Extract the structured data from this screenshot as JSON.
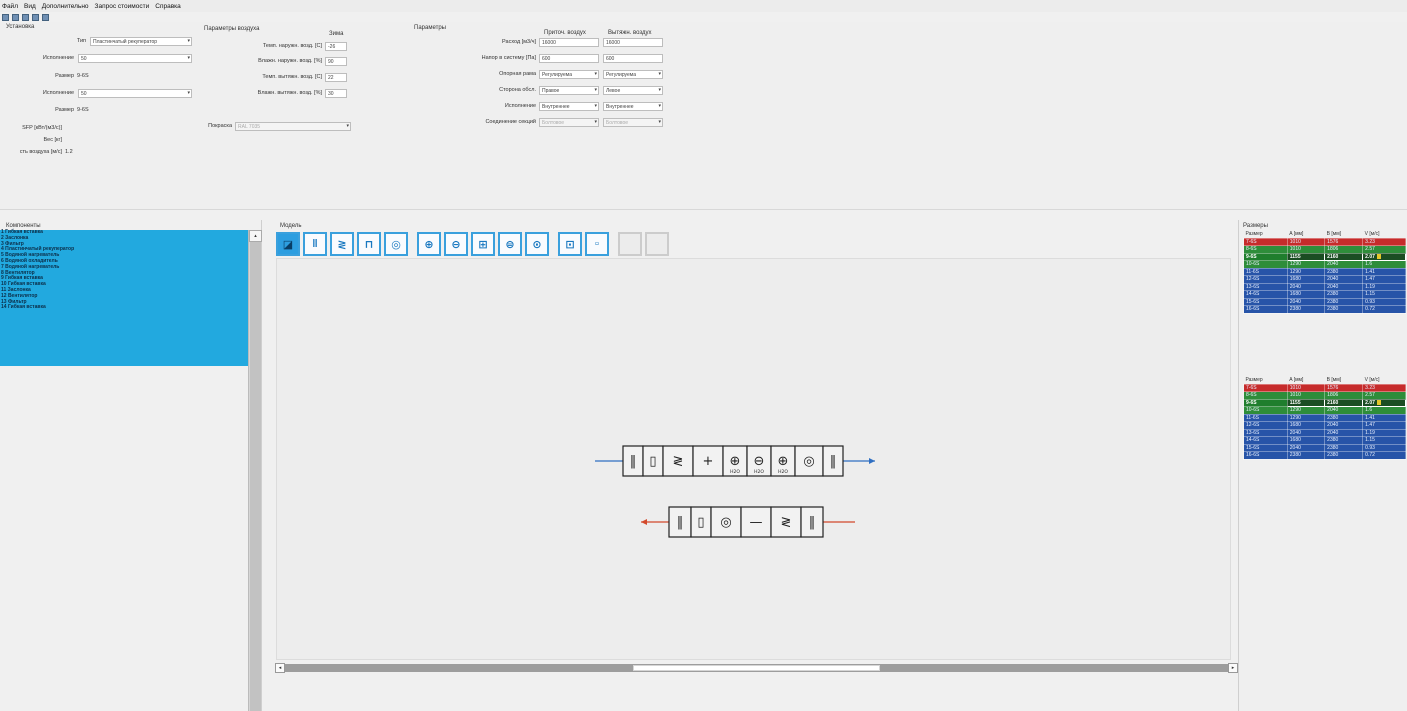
{
  "menu": [
    "Файл",
    "Вид",
    "Дополнительно",
    "Запрос стоимости",
    "Справка"
  ],
  "installation": {
    "title": "Установка",
    "type_label": "Тип",
    "type_value": "Пластинчатый рекуператор",
    "execution1_label": "Исполнение",
    "execution1_value": "50",
    "size1_label": "Размер",
    "size1_value": "9-6S",
    "execution2_label": "Исполнение",
    "execution2_value": "50",
    "size2_label": "Размер",
    "size2_value": "9-6S",
    "sfp_label": "SFP [кВт/(м3/с)]",
    "sfp_value": "",
    "weight_label": "Вес [кг]",
    "weight_value": "",
    "velocity_label": "сть воздуха [м/с]",
    "velocity_value": "1.2"
  },
  "air_params": {
    "title": "Параметры воздуха",
    "column_header": "Зима",
    "rows": [
      {
        "label": "Темп. наружн. возд. [C]",
        "value": "-26"
      },
      {
        "label": "Влажн. наружн. возд. [%]",
        "value": "90"
      },
      {
        "label": "Темп. вытяжн. возд. [C]",
        "value": "22"
      },
      {
        "label": "Влажн. вытяжн. возд. [%]",
        "value": "30"
      }
    ],
    "coating_label": "Покраска",
    "coating_value": "RAL 7035"
  },
  "params": {
    "title": "Параметры",
    "col_supply": "Приточ. воздух",
    "col_exhaust": "Вытяжн. воздух",
    "rows": [
      {
        "label": "Расход [м3/ч]",
        "supply": "16000",
        "exhaust": "16000",
        "kind": "input"
      },
      {
        "label": "Напор в систему [Па]",
        "supply": "600",
        "exhaust": "600",
        "kind": "input"
      },
      {
        "label": "Опорная рама",
        "supply": "Регулируема",
        "exhaust": "Регулируема",
        "kind": "select"
      },
      {
        "label": "Сторона обсл.",
        "supply": "Правое",
        "exhaust": "Левое",
        "kind": "select"
      },
      {
        "label": "Исполнение",
        "supply": "Внутреннее",
        "exhaust": "Внутреннее",
        "kind": "select"
      },
      {
        "label": "Соединение секций",
        "supply": "Болтовое",
        "exhaust": "Болтовое",
        "kind": "select-disabled"
      }
    ]
  },
  "components": {
    "title": "Компоненты",
    "items": [
      "1 Гибкая вставка",
      "2 Заслонка",
      "3 Фильтр",
      "4 Пластинчатый рекуператор",
      "5 Водяной нагреватель",
      "6 Водяной охладитель",
      "7 Водяной нагреватель",
      "8 Вентилятор",
      "9 Гибкая вставка",
      "10 Гибкая вставка",
      "11 Заслонка",
      "12 Вентилятор",
      "13 Фильтр",
      "14 Гибкая вставка"
    ]
  },
  "model": {
    "title": "Модель",
    "tools": [
      {
        "name": "recuperator-tool",
        "glyph": "◪",
        "selected": true
      },
      {
        "name": "flex-insert-tool",
        "glyph": "‖"
      },
      {
        "name": "filter-tool",
        "glyph": "≷"
      },
      {
        "name": "bag-filter-tool",
        "glyph": "⊓"
      },
      {
        "name": "fan-tool",
        "glyph": "◎"
      },
      {
        "name": "heater-tool",
        "glyph": "⊕"
      },
      {
        "name": "cooler-tool",
        "glyph": "⊖"
      },
      {
        "name": "electric-heater-tool",
        "glyph": "⊞"
      },
      {
        "name": "humidifier-tool",
        "glyph": "⊜"
      },
      {
        "name": "droplet-tool",
        "glyph": "⊙"
      },
      {
        "name": "silencer-tool",
        "glyph": "⊡"
      },
      {
        "name": "blank-tool",
        "glyph": "▫"
      },
      {
        "name": "disabled-tool-1",
        "glyph": "",
        "disabled": true
      },
      {
        "name": "disabled-tool-2",
        "glyph": "",
        "disabled": true
      }
    ],
    "supply_line": {
      "color": "#2f6fc2",
      "blocks": [
        "‖",
        "▯",
        "≷",
        "+",
        "⊕",
        "⊖",
        "⊕",
        "◎",
        "‖"
      ],
      "sublabels": [
        "",
        "",
        "",
        "",
        "H2O",
        "H2O",
        "H2O",
        "",
        ""
      ]
    },
    "exhaust_line": {
      "color": "#d34a2c",
      "blocks": [
        "‖",
        "▯",
        "◎",
        "—",
        "≷",
        "‖"
      ]
    }
  },
  "sizes": {
    "title": "Размеры",
    "headers": [
      "Размер",
      "A [мм]",
      "B [мм]",
      "V [м/с]"
    ],
    "table1": [
      {
        "size": "7-6S",
        "a": "1010",
        "b": "1576",
        "v": "3.23",
        "row": "red"
      },
      {
        "size": "8-6S",
        "a": "1010",
        "b": "1806",
        "v": "2.57",
        "row": "green"
      },
      {
        "size": "9-6S",
        "a": "1155",
        "b": "2160",
        "v": "2.07",
        "row": "selected",
        "flag": true
      },
      {
        "size": "10-6S",
        "a": "1290",
        "b": "2040",
        "v": "1.6",
        "row": "green"
      },
      {
        "size": "11-6S",
        "a": "1290",
        "b": "2380",
        "v": "1.41",
        "row": "blue"
      },
      {
        "size": "12-6S",
        "a": "1680",
        "b": "2040",
        "v": "1.47",
        "row": "blue"
      },
      {
        "size": "13-6S",
        "a": "2040",
        "b": "2040",
        "v": "1.19",
        "row": "blue"
      },
      {
        "size": "14-6S",
        "a": "1680",
        "b": "2380",
        "v": "1.15",
        "row": "blue"
      },
      {
        "size": "15-6S",
        "a": "2040",
        "b": "2380",
        "v": "0.93",
        "row": "blue"
      },
      {
        "size": "16-6S",
        "a": "2380",
        "b": "2380",
        "v": "0.72",
        "row": "blue"
      }
    ],
    "table2": [
      {
        "size": "7-6S",
        "a": "1010",
        "b": "1576",
        "v": "3.23",
        "row": "red"
      },
      {
        "size": "8-6S",
        "a": "1010",
        "b": "1806",
        "v": "2.57",
        "row": "green"
      },
      {
        "size": "9-6S",
        "a": "1155",
        "b": "2160",
        "v": "2.07",
        "row": "selected",
        "flag": true
      },
      {
        "size": "10-6S",
        "a": "1290",
        "b": "2040",
        "v": "1.6",
        "row": "green"
      },
      {
        "size": "11-6S",
        "a": "1290",
        "b": "2380",
        "v": "1.41",
        "row": "blue"
      },
      {
        "size": "12-6S",
        "a": "1680",
        "b": "2040",
        "v": "1.47",
        "row": "blue"
      },
      {
        "size": "13-6S",
        "a": "2040",
        "b": "2040",
        "v": "1.19",
        "row": "blue"
      },
      {
        "size": "14-6S",
        "a": "1680",
        "b": "2380",
        "v": "1.15",
        "row": "blue"
      },
      {
        "size": "15-6S",
        "a": "2040",
        "b": "2380",
        "v": "0.93",
        "row": "blue"
      },
      {
        "size": "16-6S",
        "a": "2380",
        "b": "2380",
        "v": "0.72",
        "row": "blue"
      }
    ]
  },
  "colors": {
    "selection": "#22a9df",
    "accent": "#3aa0dd"
  }
}
